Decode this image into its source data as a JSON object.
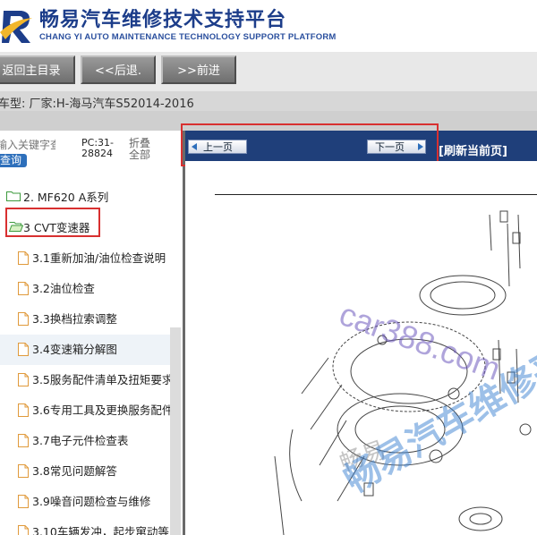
{
  "header": {
    "title": "畅易汽车维修技术支持平台",
    "subtitle": "CHANG YI AUTO MAINTENANCE TECHNOLOGY SUPPORT PLATFORM",
    "logo_icon": "cy-logo"
  },
  "toolbar": {
    "home_label": "返回主目录",
    "back_label": "<<后退.",
    "forward_label": ">>前进"
  },
  "vehicle": {
    "info": "车型:  厂家:H-海马汽车S52014-2016"
  },
  "sidebar": {
    "search_placeholder": "输入关键字查",
    "search_button": "查询",
    "pc_label": "PC:31-28824",
    "collapse_all": "折叠全部",
    "tree": [
      {
        "label": "2. MF620 A系列",
        "icon": "folder-icon"
      },
      {
        "label": "3 CVT变速器",
        "icon": "folder-open-icon"
      },
      {
        "label": "3.1重新加油/油位检查说明",
        "icon": "document-icon"
      },
      {
        "label": "3.2油位检查",
        "icon": "document-icon"
      },
      {
        "label": "3.3换档拉索调整",
        "icon": "document-icon"
      },
      {
        "label": "3.4变速箱分解图",
        "icon": "document-icon"
      },
      {
        "label": "3.5服务配件清单及扭矩要求",
        "icon": "document-icon"
      },
      {
        "label": "3.6专用工具及更换服务配件",
        "icon": "document-icon"
      },
      {
        "label": "3.7电子元件检查表",
        "icon": "document-icon"
      },
      {
        "label": "3.8常见问题解答",
        "icon": "document-icon"
      },
      {
        "label": "3.9噪音问题检查与维修",
        "icon": "document-icon"
      },
      {
        "label": "3.10车辆发冲，起步窜动等",
        "icon": "document-icon"
      }
    ]
  },
  "viewer": {
    "prev_label": "上一页",
    "next_label": "下一页",
    "refresh_label": "[刷新当前页]",
    "watermark_site": "car388.com",
    "watermark_cn": "畅易汽车维修平台",
    "watermark_misc": "畅易"
  },
  "colors": {
    "brand_blue": "#1c3d8a",
    "nav_bar": "#1f3f7a",
    "highlight_red": "#d83030",
    "button_grey": "#7d7d7d"
  }
}
